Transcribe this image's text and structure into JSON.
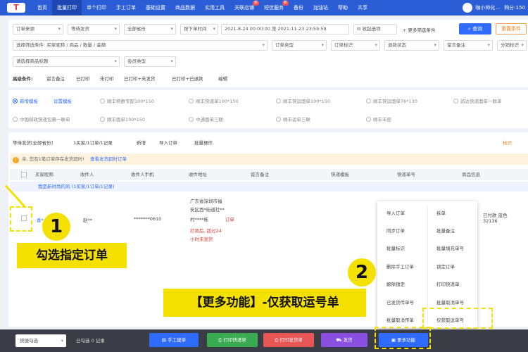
{
  "topnav": {
    "logo": "T",
    "items": [
      {
        "label": "首页",
        "active": false
      },
      {
        "label": "批量打印",
        "active": true
      },
      {
        "label": "单个打印",
        "active": false
      },
      {
        "label": "手工订单",
        "active": false
      },
      {
        "label": "基础设置",
        "active": false
      },
      {
        "label": "商品数据",
        "active": false
      },
      {
        "label": "实用工具",
        "active": false
      },
      {
        "label": "关联店铺",
        "active": false,
        "badge": "新"
      },
      {
        "label": "短信服务",
        "active": false,
        "badge": "新"
      },
      {
        "label": "备份",
        "active": false
      },
      {
        "label": "加油站",
        "active": false
      },
      {
        "label": "帮助",
        "active": false
      },
      {
        "label": "共享",
        "active": false
      }
    ],
    "user": "咖小帅化…",
    "balance": "购分:150"
  },
  "filters": {
    "row1": [
      "订单来源",
      "等待发货",
      "全部省份",
      "按下单时间",
      "2021-8-24 00:00:00 至 2021-11-23 23:59:59",
      "收起选项"
    ],
    "row1_link": "+ 更多筛选条件",
    "search_button": "查询",
    "reset_button": "重置条件",
    "row2": [
      "选择筛选条件: 买家昵称 / 商品 / 数量 / 金额",
      "订单类型",
      "订单标识",
      "退款状态",
      "留言备注",
      "分销标识"
    ],
    "row3": [
      "请选择商品标题",
      "会员类型"
    ],
    "quick_label": "高级条件:",
    "quick": [
      "留言备注",
      "已打印",
      "未打印",
      "已打印+未发货",
      "已打印+已退款"
    ],
    "quick_link": "编辑"
  },
  "templates": {
    "items": [
      {
        "label": "新增模板",
        "selected": true
      },
      {
        "label": "设置模板",
        "selected": false,
        "link": true
      },
      {
        "label": "顺丰特惠专配100*150",
        "selected": false
      },
      {
        "label": "顺丰快递单100*150",
        "selected": false
      },
      {
        "label": "顺丰快运面单100*150",
        "selected": false
      },
      {
        "label": "顺丰快运面单76*130",
        "selected": false
      },
      {
        "label": "韵达快递面单一联单",
        "selected": false
      },
      {
        "label": "中国邮政快递包裹一联单",
        "selected": false
      },
      {
        "label": "顺丰面单100*150",
        "selected": false
      },
      {
        "label": "中通面单三联",
        "selected": false
      },
      {
        "label": "顺丰运单三联",
        "selected": false
      },
      {
        "label": "顺丰丰密",
        "selected": false
      }
    ]
  },
  "listbar": {
    "status": "等待发货[全部省份]",
    "count": "1买家/1订单/1记录",
    "links": [
      "新增",
      "导入订单"
    ],
    "batch": "批量操作",
    "right": "标识"
  },
  "notice": {
    "text": "亲, 您有1笔订单存在发货超时!",
    "link": "查看发货超时订单"
  },
  "table": {
    "headers": [
      "买家昵称",
      "收件人",
      "收件人手机",
      "收件地址",
      "留言备注",
      "快递模板",
      "快递单号",
      "商品信息"
    ],
    "group": "我是新时尚的风 (1买家/1订单/1记录)",
    "row": {
      "buyer": "香*",
      "receiver": "赵**",
      "phone": "*******0610",
      "address_lines": [
        "广东省深圳市福",
        "安区西*街道社**",
        "村****栋"
      ],
      "status": "订单",
      "alert_lines": [
        "打款后, 超过24",
        "小时未发货"
      ],
      "product": "已付款 蓝色",
      "code": "32136"
    }
  },
  "menu": {
    "left": [
      "导入订单",
      "同步订单",
      "批量标识",
      "删除手工订单",
      "解除锁定",
      "已发货传单号",
      "批量取消传单"
    ],
    "right": [
      "拆单",
      "批量备注",
      "批量填充单号",
      "锁定订单",
      "打印快递单",
      "批量取消单号",
      "仅获取运单号"
    ]
  },
  "bottom": {
    "select": "快捷勾选",
    "selected": "已勾选 0 记录",
    "buttons": [
      {
        "label": "手工建单",
        "color": "#2f6bff"
      },
      {
        "label": "打印快递单",
        "color": "#3aab51"
      },
      {
        "label": "打印发货单",
        "color": "#e85555"
      },
      {
        "label": "发货",
        "color": "#8a4fe0"
      },
      {
        "label": "更多功能",
        "color": "#2f6bff"
      }
    ]
  },
  "annotations": {
    "step1_number": "1",
    "step1_text": "勾选指定订单",
    "step2_number": "2",
    "step2_text": "【更多功能】-仅获取运号单"
  },
  "colors": {
    "nav": "#2b5ed6",
    "primary": "#2f6bff",
    "highlight": "#f5e100",
    "bottombar": "#3a3d45"
  }
}
